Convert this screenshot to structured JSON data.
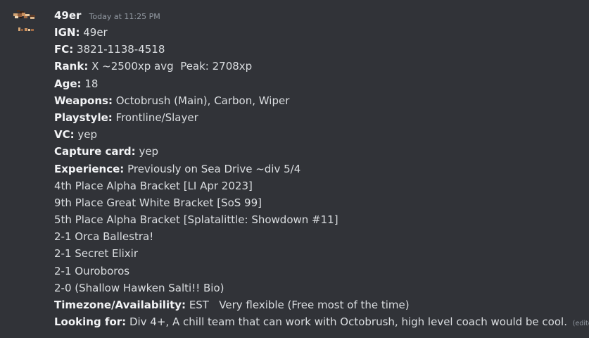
{
  "message": {
    "author": "49er",
    "timestamp": "Today at 11:25 PM",
    "edited_label": "(edited)",
    "fields": {
      "ign": {
        "label": "IGN:",
        "value": "49er"
      },
      "fc": {
        "label": "FC:",
        "value": "3821-1138-4518"
      },
      "rank": {
        "label": "Rank:",
        "value": "X ~2500xp avg  Peak: 2708xp"
      },
      "age": {
        "label": "Age:",
        "value": "18"
      },
      "weapons": {
        "label": "Weapons:",
        "value": "Octobrush (Main), Carbon, Wiper"
      },
      "playstyle": {
        "label": "Playstyle:",
        "value": "Frontline/Slayer"
      },
      "vc": {
        "label": "VC:",
        "value": "yep"
      },
      "capture_card": {
        "label": "Capture card:",
        "value": "yep"
      },
      "experience": {
        "label": "Experience:",
        "value": "Previously on Sea Drive ~div 5/4"
      },
      "timezone": {
        "label": "Timezone/Availability:",
        "value": "EST   Very flexible (Free most of the time)"
      },
      "looking_for": {
        "label": "Looking for:",
        "value": "Div 4+, A chill team that can work with Octobrush, high level coach would be cool."
      }
    },
    "experience_lines": [
      "4th Place Alpha Bracket [LI Apr 2023]",
      "9th Place Great White Bracket [SoS 99]",
      "5th Place Alpha Bracket [Splatalittle: Showdown #11]",
      "2-1 Orca Ballestra!",
      "2-1 Secret Elixir",
      "2-1 Ouroboros",
      "2-0 (Shallow Hawken Salti!! Bio)"
    ]
  },
  "colors": {
    "background": "#313338",
    "text": "#dbdee1",
    "username": "#f2f3f5",
    "muted": "#949ba4"
  },
  "icons": {
    "avatar": "pixel-art-avatar-icon"
  }
}
